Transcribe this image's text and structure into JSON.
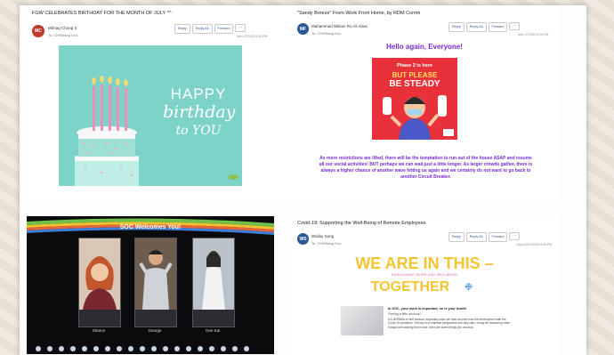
{
  "toolbar": {
    "reply": "Reply",
    "reply_all": "Reply All",
    "forward": "Forward",
    "more": "···"
  },
  "emails": {
    "birthday": {
      "subject": "FGW CELEBRATES BIRTHDAY FOR THE MONTH OF JULY ^^",
      "avatar_initials": "MC",
      "sender": "Wilnag Chong S",
      "to": "To: CHRMsng Gov",
      "date": "Mon 07/2020 5:00 PM",
      "card": {
        "line1": "HAPPY",
        "line2": "birthday",
        "line3": "to YOU"
      }
    },
    "sandy": {
      "subject": "\"Sandy Breeze\" From Work From Home, by RDM Comm",
      "avatar_initials": "MF",
      "sender": "Muhammad Wiliam Ro Ali Abas",
      "to": "To: CHRMsng Gov",
      "date": "Mon 07/2020 5:00 PM",
      "greeting": "Hello again, Everyone!",
      "poster": {
        "line1": "Phase 2 is here",
        "line2": "BUT PLEASE",
        "line3": "BE STEADY"
      },
      "body": "As more restrictions are lifted, there will be the temptation to run out of the house ASAP and resume all our social activities! BUT perhaps we can wait just a little longer. As larger crowds gather, there is always a higher chance of another wave hitting us again and we certainly do not want to go back to another Circuit Breaker."
    },
    "zoom": {
      "title": "SOC Welcomes You!",
      "participants": [
        "Sharon",
        "George",
        "Gee Kai"
      ]
    },
    "covid": {
      "subject": "Covid-19: Supporting the Well-Being of Remote Employees",
      "avatar_initials": "WS",
      "sender": "Wailay Song",
      "to": "To: CHRMsng Gov",
      "date": "Mon 15/07/2020 5:00 PM",
      "headline1": "WE ARE IN THIS –",
      "subline": "MAINTAINING WORK AND WELLBEING",
      "headline2": "TOGETHER",
      "article_title": "In SOC, your work is important, so is your health",
      "article_sub": "Feeling a little anxious?",
      "article_body": "It is NORMAL to feel anxious, especially when we hear and see how the development with the Covid-19 pandemic. The key is to maintain perspective and stay calm. It may be reassuring when it stays with working from home, there are some things you could do."
    }
  },
  "colors": {
    "avatar_red": "#c0392b",
    "avatar_blue": "#2b5797",
    "purple": "#7a2bd6",
    "teal": "#7dd3c8",
    "poster_red": "#e8313a",
    "gold": "#f4c431"
  }
}
